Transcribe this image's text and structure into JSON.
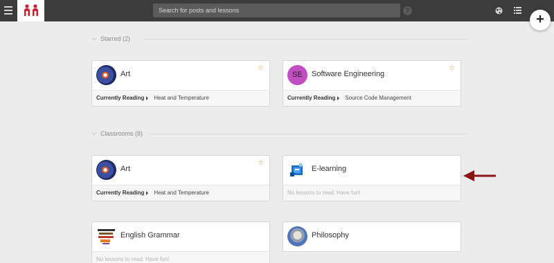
{
  "topbar": {
    "search_placeholder": "Search for posts and lessons",
    "help_label": "?",
    "fab_label": "+"
  },
  "sections": {
    "starred": "Starred (2)",
    "classrooms": "Classrooms (8)"
  },
  "starred": [
    {
      "title": "Art",
      "reading_label": "Currently Reading",
      "reading_value": "Heat and Temperature",
      "starred": true,
      "thumb": "art-thumbnail"
    },
    {
      "title": "Software Engineering",
      "initials": "SE",
      "reading_label": "Currently Reading",
      "reading_value": "Source Code Management",
      "starred": true,
      "thumb": "se-initials-avatar"
    }
  ],
  "classrooms": [
    {
      "title": "Art",
      "reading_label": "Currently Reading",
      "reading_value": "Heat and Temperature",
      "starred": true
    },
    {
      "title": "E-learning",
      "empty_text": "No lessons to read. Have fun!"
    },
    {
      "title": "English Grammar",
      "empty_text": "No lessons to read. Have fun!"
    },
    {
      "title": "Philosophy"
    }
  ],
  "colors": {
    "topbar": "#3c3c3c",
    "logo_red": "#c8202f",
    "star": "#d08a17",
    "arrow": "#8b1414",
    "se_avatar": "#c24fc2"
  }
}
